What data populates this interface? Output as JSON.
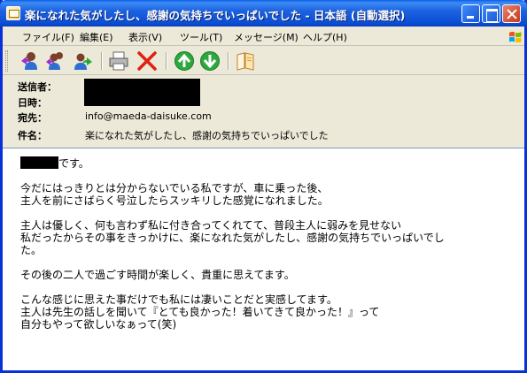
{
  "window": {
    "title": "楽になれた気がしたし、感謝の気持ちでいっぱいでした - 日本語 (自動選択)"
  },
  "menu": {
    "items": [
      {
        "label": "ファイル(F)"
      },
      {
        "label": "編集(E)"
      },
      {
        "label": "表示(V)"
      },
      {
        "label": "ツール(T)"
      },
      {
        "label": "メッセージ(M)"
      },
      {
        "label": "ヘルプ(H)"
      }
    ]
  },
  "toolbar": {
    "icons": [
      "reply-icon",
      "reply-all-icon",
      "forward-icon",
      "print-icon",
      "delete-icon",
      "previous-icon",
      "next-icon",
      "address-book-icon"
    ]
  },
  "header": {
    "from_label": "送信者：",
    "date_label": "日時：",
    "to_label": "宛先：",
    "to_value": "info@maeda-daisuke.com",
    "subject_label": "件名：",
    "subject_value": "楽になれた気がしたし、感謝の気持ちでいっぱいでした"
  },
  "message": {
    "greeting_suffix": "です。",
    "paragraphs": [
      "今だにはっきりとは分からないでいる私ですが、車に乗った後、\n主人を前にさばらく号泣したらスッキリした感覚になれました。",
      "主人は優しく、何も言わず私に付き合ってくれてて、普段主人に弱みを見せない\n私だったからその事をきっかけに、楽になれた気がしたし、感謝の気持ちでいっぱいでし\nた。",
      "その後の二人で過ごす時間が楽しく、貴重に思えてます。",
      "こんな感じに思えた事だけでも私には凄いことだと実感してます。\n主人は先生の話しを聞いて『とても良かった！着いてきて良かった！』って\n自分もやって欲しいなぁって(笑)"
    ]
  },
  "colors": {
    "titlebar": "#0b4fd6",
    "chrome": "#ece9d8",
    "close_button": "#c4391c"
  }
}
